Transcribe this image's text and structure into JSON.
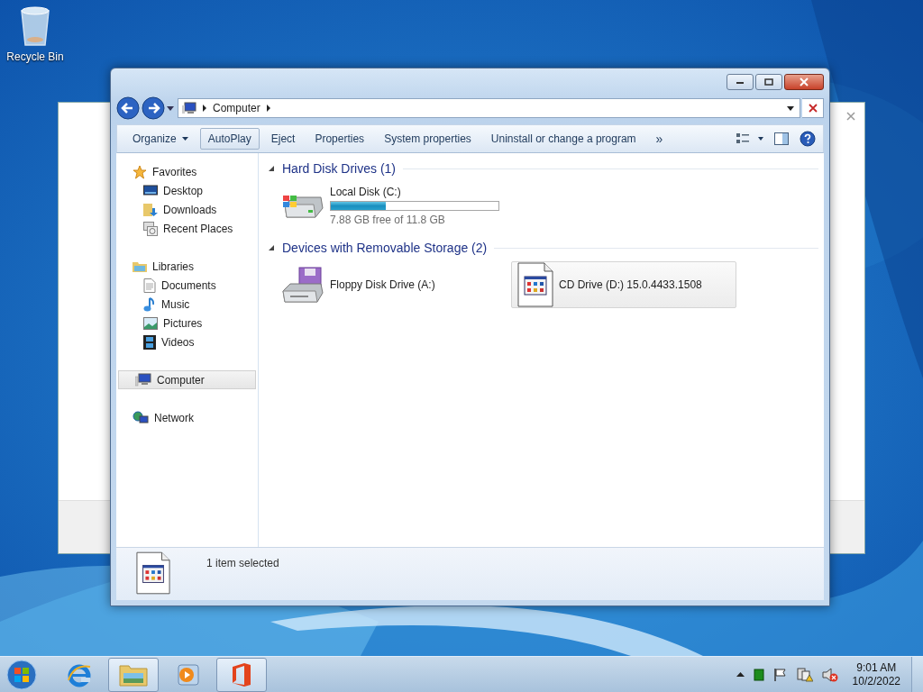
{
  "desktop_icons": [
    {
      "label": "Recycle Bin",
      "kind": "recycle"
    }
  ],
  "explorer": {
    "address": {
      "crumbs": [
        "Computer"
      ]
    },
    "toolbar": [
      {
        "label": "Organize",
        "kind": "menu",
        "hovered": false
      },
      {
        "label": "AutoPlay",
        "kind": "button",
        "hovered": true
      },
      {
        "label": "Eject",
        "kind": "button",
        "hovered": false
      },
      {
        "label": "Properties",
        "kind": "button",
        "hovered": false
      },
      {
        "label": "System properties",
        "kind": "button",
        "hovered": false
      },
      {
        "label": "Uninstall or change a program",
        "kind": "button",
        "hovered": false
      }
    ],
    "toolbar_more": "»",
    "nav": [
      {
        "label": "Favorites",
        "kind": "star",
        "selected": false,
        "children": [
          {
            "label": "Desktop",
            "kind": "desktop",
            "selected": false
          },
          {
            "label": "Downloads",
            "kind": "downloads",
            "selected": false
          },
          {
            "label": "Recent Places",
            "kind": "recent",
            "selected": false
          }
        ]
      },
      {
        "label": "Libraries",
        "kind": "library",
        "selected": false,
        "children": [
          {
            "label": "Documents",
            "kind": "documents",
            "selected": false
          },
          {
            "label": "Music",
            "kind": "music",
            "selected": false
          },
          {
            "label": "Pictures",
            "kind": "pictures",
            "selected": false
          },
          {
            "label": "Videos",
            "kind": "videos",
            "selected": false
          }
        ]
      },
      {
        "label": "Computer",
        "kind": "computer",
        "selected": true
      },
      {
        "label": "Network",
        "kind": "network",
        "selected": false
      }
    ],
    "sections": [
      {
        "title": "Hard Disk Drives (1)",
        "expanded": true,
        "items": [
          {
            "name": "Local Disk (C:)",
            "kind": "disk",
            "level": 0.33,
            "reading": "7.88 GB free of 11.8 GB",
            "selected": false
          }
        ]
      },
      {
        "title": "Devices with Removable Storage (2)",
        "expanded": true,
        "items": [
          {
            "name": "Floppy Disk Drive (A:)",
            "kind": "floppy",
            "selected": false
          },
          {
            "name": "CD Drive (D:) 15.0.4433.1508",
            "kind": "cd",
            "selected": true
          }
        ]
      }
    ],
    "status": "1 item selected"
  },
  "taskbar": {
    "apps": [
      {
        "kind": "ie",
        "open": false
      },
      {
        "kind": "explorer",
        "open": true
      },
      {
        "kind": "media",
        "open": false
      },
      {
        "kind": "office",
        "open": true
      }
    ],
    "clock": {
      "time": "9:01 AM",
      "date": "10/2/2022"
    }
  }
}
